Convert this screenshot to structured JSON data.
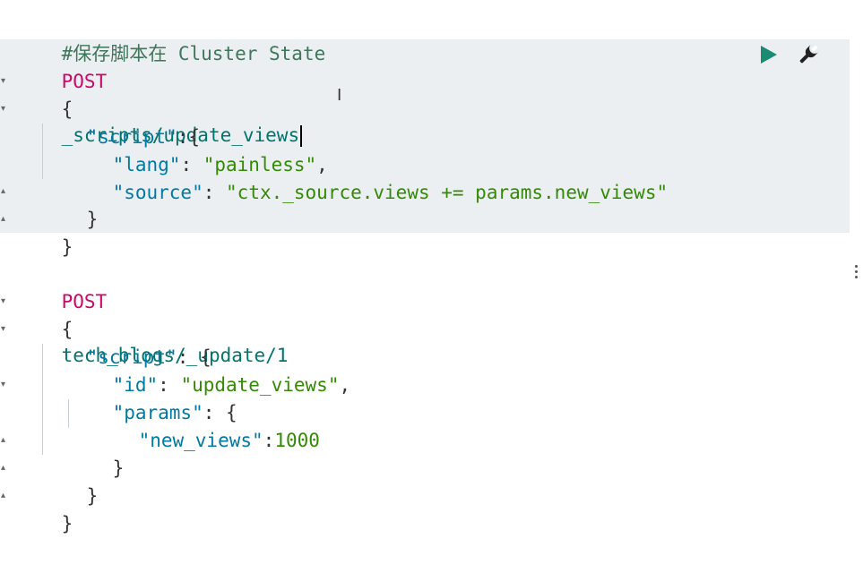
{
  "editor": {
    "comment": "#保存脚本在 Cluster State",
    "request1": {
      "method": "POST",
      "path": "_scripts/update_views",
      "body": {
        "open_brace": "{",
        "script_key": "\"script\"",
        "script_open": ":{",
        "lang_key": "\"lang\"",
        "lang_sep": ": ",
        "lang_value": "\"painless\"",
        "lang_comma": ",",
        "source_key": "\"source\"",
        "source_sep": ": ",
        "source_value": "\"ctx._source.views += params.new_views\"",
        "script_close": "}",
        "close_brace": "}"
      }
    },
    "request2": {
      "method": "POST",
      "path": "tech_blogs/_update/1",
      "body": {
        "open_brace": "{",
        "script_key": "\"script\"",
        "script_open": ": {",
        "id_key": "\"id\"",
        "id_sep": ": ",
        "id_value": "\"update_views\"",
        "id_comma": ",",
        "params_key": "\"params\"",
        "params_open": ": {",
        "new_views_key": "\"new_views\"",
        "new_views_sep": ":",
        "new_views_value": "1000",
        "params_close": "}",
        "script_close": "}",
        "close_brace": "}"
      }
    }
  },
  "icons": {
    "run": "play-icon",
    "settings": "wrench-icon",
    "more": "vertical-ellipsis-icon",
    "pointer": "text-cursor-icon"
  },
  "colors": {
    "active_background": "#eceff2",
    "method": "#c80a68",
    "url": "#00756c",
    "key": "#0079a5",
    "string": "#348a05",
    "comment": "#41755c",
    "run_button": "#1b8a73"
  }
}
